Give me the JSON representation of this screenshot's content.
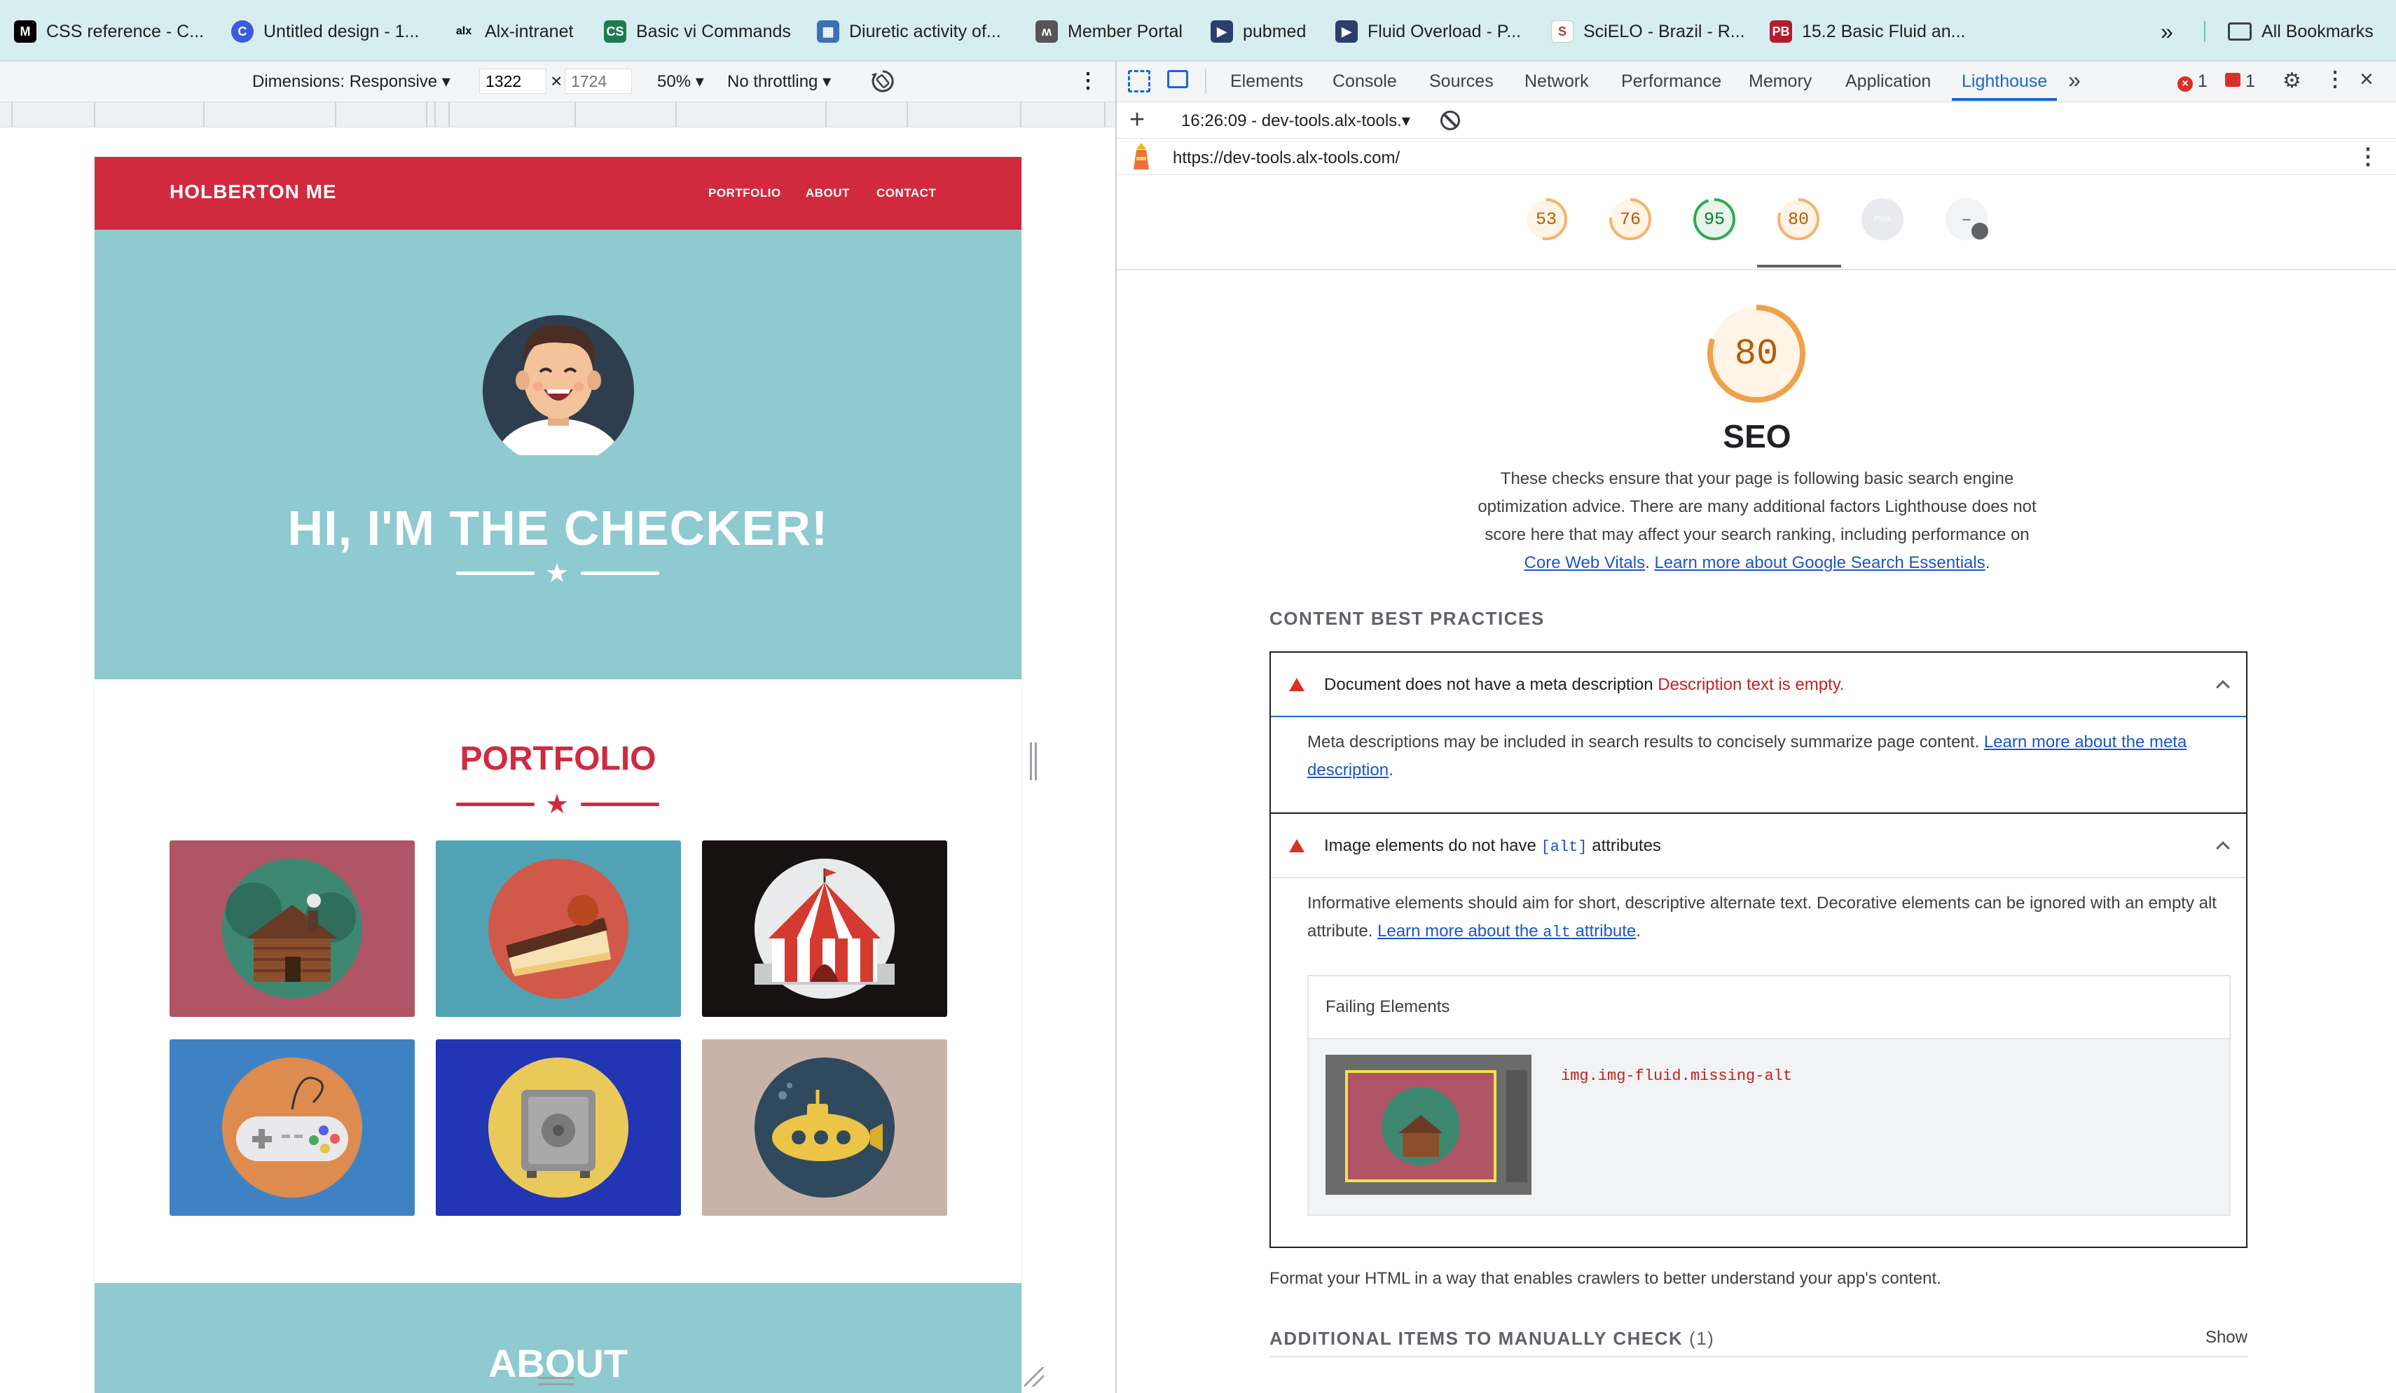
{
  "bookmarks": [
    {
      "label": "CSS reference - C...",
      "icon": "mdn-icon",
      "color": "#000000"
    },
    {
      "label": "Untitled design - 1...",
      "icon": "canva-icon",
      "color": "#3b5bdb"
    },
    {
      "label": "Alx-intranet",
      "icon": "alx-icon",
      "color": "#000000"
    },
    {
      "label": "Basic vi Commands",
      "icon": "cs-icon",
      "color": "#1e7b4f"
    },
    {
      "label": "Diuretic activity of...",
      "icon": "grid-icon",
      "color": "#3d6fb6"
    },
    {
      "label": "Member Portal",
      "icon": "portal-icon",
      "color": "#555555"
    },
    {
      "label": "pubmed",
      "icon": "folder-doc-icon",
      "color": "#2c3e6b"
    },
    {
      "label": "Fluid Overload - P...",
      "icon": "folder-doc-icon",
      "color": "#2c3e6b"
    },
    {
      "label": "SciELO - Brazil - R...",
      "icon": "scielo-icon",
      "color": "#c0392b"
    },
    {
      "label": "15.2 Basic Fluid an...",
      "icon": "pb-icon",
      "color": "#b01e2b"
    }
  ],
  "bookmarks_more": "»",
  "all_bookmarks": "All Bookmarks",
  "device_toolbar": {
    "dimensions": "Dimensions: Responsive",
    "width": "1322",
    "times": "×",
    "height_placeholder": "1724",
    "zoom": "50%",
    "throttling": "No throttling"
  },
  "site": {
    "brand": "HOLBERTON ME",
    "nav": [
      "PORTFOLIO",
      "ABOUT",
      "CONTACT"
    ],
    "hero_title": "HI, I'M THE CHECKER!",
    "portfolio_title": "PORTFOLIO",
    "about_title": "ABOUT",
    "colors": {
      "red": "#d12a3f",
      "teal": "#8ecacf"
    },
    "tiles": [
      {
        "name": "cabin",
        "bg": "#b05566"
      },
      {
        "name": "cake",
        "bg": "#52a2b6"
      },
      {
        "name": "circus",
        "bg": "#161211"
      },
      {
        "name": "game-controller",
        "bg": "#3f82c3"
      },
      {
        "name": "safe",
        "bg": "#2235b3"
      },
      {
        "name": "submarine",
        "bg": "#c9b3a8"
      }
    ]
  },
  "devtools": {
    "tabs": [
      "Elements",
      "Console",
      "Sources",
      "Network",
      "Performance",
      "Memory",
      "Application",
      "Lighthouse"
    ],
    "active_tab": "Lighthouse",
    "error_count": "1",
    "issue_count": "1",
    "report_time": "16:26:09 - dev-tools.alx-tools.",
    "url": "https://dev-tools.alx-tools.com/",
    "scores": [
      {
        "value": 53,
        "label": "53",
        "color": "#e67700"
      },
      {
        "value": 76,
        "label": "76",
        "color": "#e67700"
      },
      {
        "value": 95,
        "label": "95",
        "color": "#0c9d43"
      },
      {
        "value": 80,
        "label": "80",
        "color": "#e67700"
      },
      {
        "value": null,
        "label": "PWA",
        "color": "#bdc1c6"
      },
      {
        "value": null,
        "label": "–",
        "color": "#bdc1c6"
      }
    ],
    "seo": {
      "score": "80",
      "score_value": 80,
      "title": "SEO",
      "desc_1": "These checks ensure that your page is following basic search engine optimization advice. There are many additional factors Lighthouse does not score here that may affect your search ranking, including performance on ",
      "link_cwv": "Core Web Vitals",
      "desc_sep": ". ",
      "link_google": "Learn more about Google Search Essentials",
      "desc_end": "."
    },
    "content_best_practices": "CONTENT BEST PRACTICES",
    "audit_meta": {
      "title": "Document does not have a meta description",
      "detail": "Description text is empty.",
      "body": "Meta descriptions may be included in search results to concisely summarize page content. ",
      "link": "Learn more about the meta description",
      "end": "."
    },
    "audit_alt": {
      "title_pre": "Image elements do not have ",
      "title_code": "[alt]",
      "title_post": " attributes",
      "body": "Informative elements should aim for short, descriptive alternate text. Decorative elements can be ignored with an empty alt attribute. ",
      "link_pre": "Learn more about the ",
      "link_code": "alt",
      "link_post": " attribute",
      "end": ".",
      "failing_label": "Failing Elements",
      "selector": "img.img-fluid.missing-alt"
    },
    "format_text": "Format your HTML in a way that enables crawlers to better understand your app's content.",
    "manual_title": "ADDITIONAL ITEMS TO MANUALLY CHECK",
    "manual_count": "(1)",
    "show_label": "Show"
  }
}
